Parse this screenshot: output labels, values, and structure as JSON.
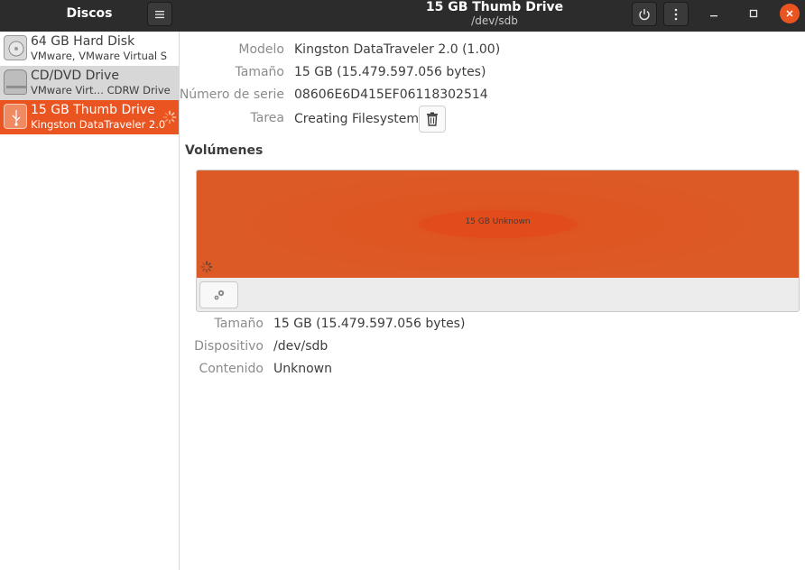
{
  "app": {
    "sidebar_title": "Discos",
    "window_title": "15 GB Thumb Drive",
    "window_subtitle": "/dev/sdb"
  },
  "icons": {
    "menu": "hamburger-icon",
    "power": "power-icon",
    "more": "vertical-dots-icon",
    "minimize": "minimize-icon",
    "maximize": "maximize-icon",
    "close": "close-icon",
    "trash": "trash-icon",
    "gear": "gear-icon",
    "spinner": "spinner-icon"
  },
  "colors": {
    "accent": "#e95420",
    "header_bg": "#2c2c2c",
    "selected_row": "#e95420"
  },
  "drives": [
    {
      "name": "64 GB Hard Disk",
      "sub": "VMware, VMware Virtual S",
      "icon": "hard-disk-icon"
    },
    {
      "name": "CD/DVD Drive",
      "sub": "VMware Virt… CDRW Drive",
      "icon": "optical-drive-icon"
    },
    {
      "name": "15 GB Thumb Drive",
      "sub": "Kingston DataTraveler 2.0",
      "icon": "usb-drive-icon",
      "selected": true
    }
  ],
  "details": {
    "model_label": "Modelo",
    "model_value": "Kingston DataTraveler 2.0 (1.00)",
    "size_label": "Tamaño",
    "size_value": "15 GB (15.479.597.056 bytes)",
    "serial_label": "Número de serie",
    "serial_value": "08606E6D415EF06118302514",
    "task_label": "Tarea",
    "task_value": "Creating Filesystem"
  },
  "volumes": {
    "title": "Volúmenes",
    "partition_label": "15 GB Unknown"
  },
  "partition_details": {
    "size_label": "Tamaño",
    "size_value": "15 GB (15.479.597.056 bytes)",
    "device_label": "Dispositivo",
    "device_value": "/dev/sdb",
    "contents_label": "Contenido",
    "contents_value": "Unknown"
  }
}
